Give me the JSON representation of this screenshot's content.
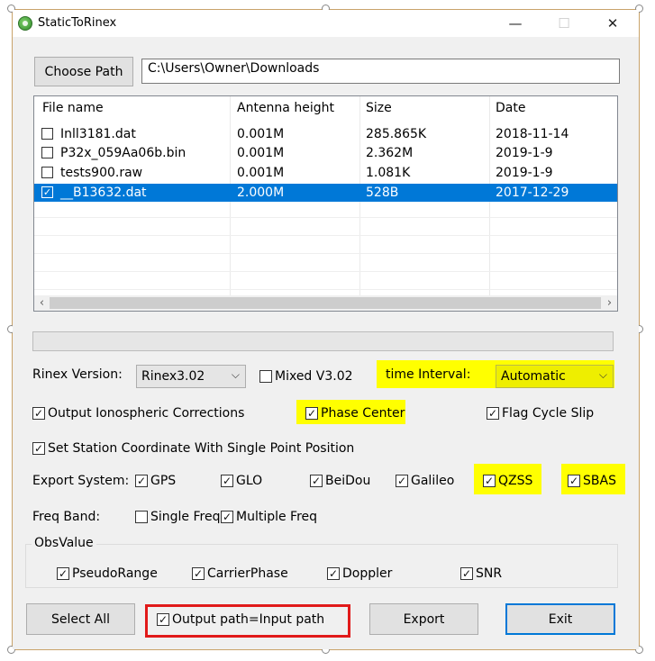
{
  "window": {
    "title": "StaticToRinex",
    "minimize_glyph": "—",
    "maximize_glyph": "☐",
    "close_glyph": "✕"
  },
  "path": {
    "choose_label": "Choose Path",
    "value": "C:\\Users\\Owner\\Downloads"
  },
  "file_list": {
    "columns": [
      "File name",
      "Antenna height",
      "Size",
      "Date"
    ],
    "rows": [
      {
        "name": "Inll3181.dat",
        "antenna": "0.001M",
        "size": "285.865K",
        "date": "2018-11-14",
        "checked": false,
        "selected": false
      },
      {
        "name": "P32x_059Aa06b.bin",
        "antenna": "0.001M",
        "size": "2.362M",
        "date": "2019-1-9",
        "checked": false,
        "selected": false
      },
      {
        "name": "tests900.raw",
        "antenna": "0.001M",
        "size": "1.081K",
        "date": "2019-1-9",
        "checked": false,
        "selected": false
      },
      {
        "name": "__B13632.dat",
        "antenna": "2.000M",
        "size": "528B",
        "date": "2017-12-29",
        "checked": true,
        "selected": true
      }
    ],
    "scroll_left": "‹",
    "scroll_right": "›"
  },
  "progress": {
    "value": 0
  },
  "rinex": {
    "version_label": "Rinex Version:",
    "version_value": "Rinex3.02",
    "mixed_label": "Mixed V3.02",
    "mixed_checked": false,
    "interval_label": "time Interval:",
    "interval_value": "Automatic"
  },
  "options": {
    "iono_label": "Output Ionospheric Corrections",
    "iono_checked": true,
    "phase_center_label": "Phase Center",
    "phase_center_checked": true,
    "flag_cycle_slip_label": "Flag Cycle Slip",
    "flag_cycle_slip_checked": true,
    "station_coord_label": "Set Station Coordinate With Single Point Position",
    "station_coord_checked": true
  },
  "export_system": {
    "label": "Export System:",
    "gps": "GPS",
    "glo": "GLO",
    "beidou": "BeiDou",
    "galileo": "Galileo",
    "qzss": "QZSS",
    "sbas": "SBAS"
  },
  "freq_band": {
    "label": "Freq Band:",
    "single": "Single Freq",
    "single_checked": false,
    "multiple": "Multiple Freq",
    "multiple_checked": true
  },
  "obs_value": {
    "group_title": "ObsValue",
    "pseudo_range": "PseudoRange",
    "carrier_phase": "CarrierPhase",
    "doppler": "Doppler",
    "snr": "SNR"
  },
  "footer": {
    "select_all": "Select All",
    "output_path_label": "Output path=Input path",
    "output_path_checked": true,
    "export": "Export",
    "exit": "Exit"
  },
  "glyphs": {
    "check": "✓",
    "dropdown": "⌵"
  },
  "colors": {
    "highlight": "#ffff00",
    "selection": "#0078d7",
    "annotation_red": "#e11a1a",
    "exit_border": "#0078d7"
  },
  "icons": {
    "app": "green-globe-icon"
  }
}
